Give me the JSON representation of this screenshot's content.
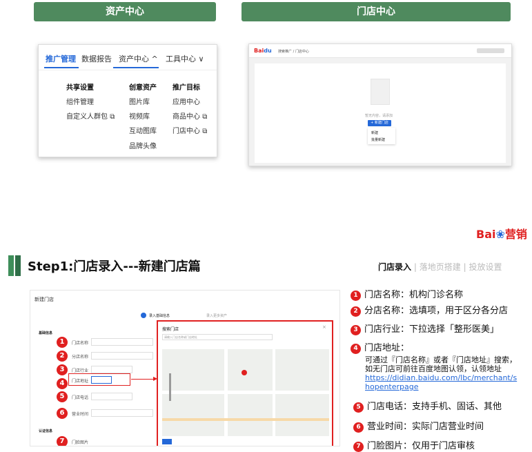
{
  "top_buttons": {
    "asset": "资产中心",
    "store": "门店中心"
  },
  "nav": {
    "tabs": [
      "推广管理",
      "数据报告",
      "资产中心 ^",
      "工具中心 ∨"
    ],
    "menu": {
      "col1": {
        "head": "共享设置",
        "items": [
          "组件管理",
          "自定义人群包"
        ]
      },
      "col2": {
        "head": "创意资产",
        "items": [
          "图片库",
          "视频库",
          "互动图库",
          "品牌头像"
        ]
      },
      "col3": {
        "head": "推广目标",
        "items": [
          "应用中心",
          "商品中心",
          "门店中心"
        ]
      }
    }
  },
  "store_shot": {
    "breadcrumb": "搜索推广 / 门店中心",
    "empty": "暂无内容，请添加",
    "new_btn": "+ 新建门店",
    "opt1": "新建",
    "opt2": "批量新建"
  },
  "brand": {
    "logo_text": "Bai",
    "logo_suffix": "营销"
  },
  "heading": "Step1:门店录入---新建门店篇",
  "steps": {
    "active": "门店录入",
    "sep": "|",
    "s2": "落地页搭建",
    "s3": "投放设置"
  },
  "form": {
    "title": "新建门店",
    "step1": "录入基础信息",
    "step2": "录入更多资产",
    "section1": "基础信息",
    "section2": "认证信息",
    "fields": [
      "门店名称",
      "分店名称",
      "门店行业",
      "门店地址",
      "门店电话",
      "营业时间",
      "门脸图片"
    ],
    "modal_title": "搜索门店",
    "modal_search": "请输入门店名称或门店地址"
  },
  "notes": [
    {
      "n": "1",
      "text": "门店名称：机构门诊名称"
    },
    {
      "n": "2",
      "text": "分店名称：选填项，用于区分各分店"
    },
    {
      "n": "3",
      "text": "门店行业：下拉选择「整形医美」"
    },
    {
      "n": "4",
      "text": "门店地址："
    },
    {
      "n": "5",
      "text": "门店电话：支持手机、固话、其他"
    },
    {
      "n": "6",
      "text": "营业时间：实际门店营业时间"
    },
    {
      "n": "7",
      "text": "门脸图片：仅用于门店审核"
    }
  ],
  "address_note": {
    "line1": "可通过『门店名称』或者『门店地址』搜索，",
    "line2": "如无门店可前往百度地图认领，认领地址",
    "link": "https://didian.baidu.com/lbc/merchant/shopenterpage",
    "link1": "https://didian.baidu.com/lbc/merchant/s",
    "link2": "hopenterpage"
  },
  "colors": {
    "green": "#4f8a5e",
    "red": "#e02020",
    "blue": "#2468d8"
  }
}
